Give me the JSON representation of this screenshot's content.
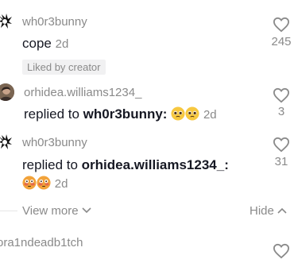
{
  "comments": [
    {
      "username": "wh0r3bunny",
      "text": "cope",
      "time": "2d",
      "likes": "245",
      "badge": "Liked by creator"
    },
    {
      "username": "orhidea.williams1234_",
      "reply_prefix": "replied to",
      "reply_to": "wh0r3bunny:",
      "time": "2d",
      "likes": "3",
      "emoji": [
        "pleading-face",
        "pleading-face"
      ]
    },
    {
      "username": "wh0r3bunny",
      "reply_prefix": "replied to",
      "reply_to": "orhidea.williams1234_:",
      "time": "2d",
      "likes": "31",
      "emoji": [
        "flushed-face",
        "flushed-face"
      ]
    }
  ],
  "thread": {
    "view_more": "View more",
    "hide": "Hide"
  },
  "next_comment": {
    "username": "ora1ndeadb1tch"
  },
  "colors": {
    "text": "#161823",
    "secondary": "#8a8a8a",
    "badge_bg": "#f1f1f2"
  }
}
